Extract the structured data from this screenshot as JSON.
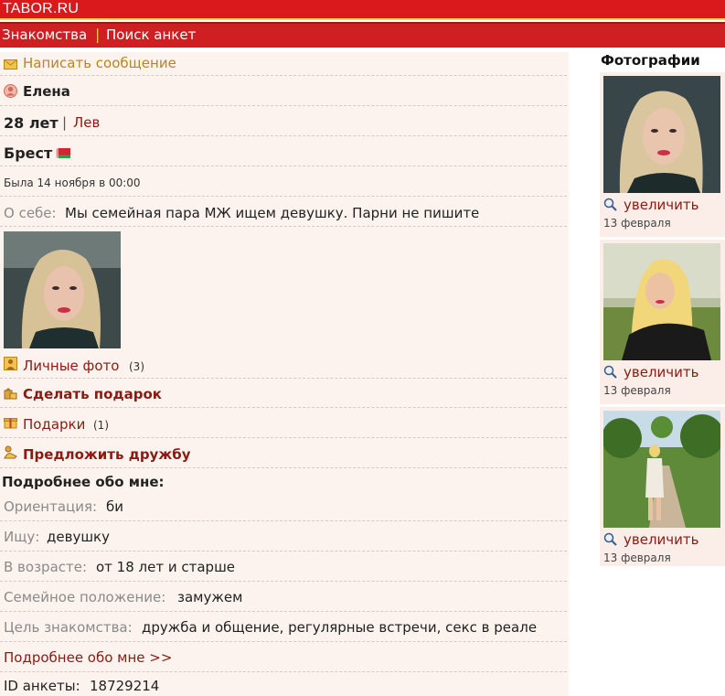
{
  "header": {
    "logo": "TABOR.RU",
    "nav": [
      "Знакомства",
      "Поиск анкет"
    ],
    "nav_separator": "|"
  },
  "profile": {
    "write_message": "Написать сообщение",
    "name": "Елена",
    "age": "28 лет",
    "age_sep": "|",
    "zodiac": "Лев",
    "city": "Брест",
    "last_seen": "Была 14 ноября в 00:00",
    "about_label": "О себе:",
    "about_text": "Мы семейная пара МЖ ищем девушку. Парни не пишите",
    "personal_photos": "Личные фото",
    "personal_photos_count": "(3)",
    "make_gift": "Сделать подарок",
    "gifts": "Подарки",
    "gifts_count": "(1)",
    "offer_friendship": "Предложить дружбу",
    "details_heading": "Подробнее обо мне:",
    "details": [
      {
        "label": "Ориентация:",
        "value": "би"
      },
      {
        "label": "Ищу:",
        "value": "девушку"
      },
      {
        "label": "В возрасте:",
        "value": "от 18 лет и старше"
      },
      {
        "label": "Семейное положение:",
        "value": "замужем"
      },
      {
        "label": "Цель знакомства:",
        "value": "дружба и общение, регулярные встречи, секс в реале"
      }
    ],
    "more_link": "Подробнее обо мне >>",
    "id_label": "ID анкеты:",
    "id_value": "18729214"
  },
  "sidebar": {
    "title": "Фотографии",
    "photos": [
      {
        "zoom_label": "увеличить",
        "date": "13 февраля"
      },
      {
        "zoom_label": "увеличить",
        "date": "13 февраля"
      },
      {
        "zoom_label": "увеличить",
        "date": "13 февраля"
      }
    ]
  },
  "colors": {
    "header_red": "#d9191c",
    "nav_red": "#cf1f22",
    "panel_bg": "#fdf3ee",
    "link_dark_red": "#8b1a12",
    "link_gold": "#b8861e"
  }
}
